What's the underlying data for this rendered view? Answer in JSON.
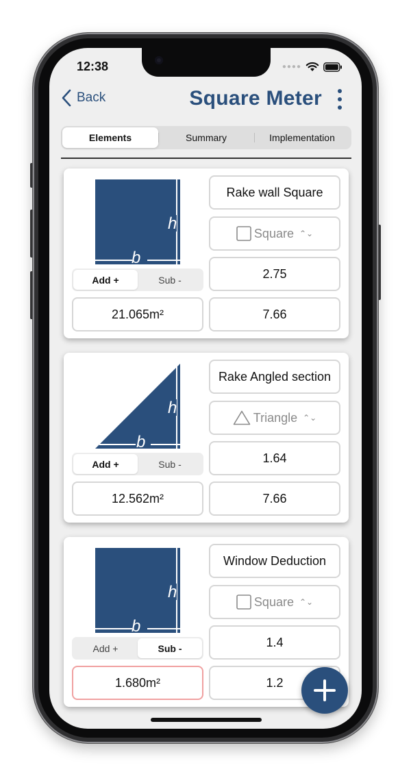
{
  "status": {
    "time": "12:38"
  },
  "nav": {
    "back_label": "Back",
    "title": "Square Meter"
  },
  "tabs": [
    {
      "label": "Elements",
      "active": true
    },
    {
      "label": "Summary",
      "active": false
    },
    {
      "label": "Implementation",
      "active": false
    }
  ],
  "cards": [
    {
      "shape": "square",
      "name": "Rake wall Square",
      "shape_label": "Square",
      "height": "2.75",
      "base": "7.66",
      "area": "21.065m²",
      "add_label": "Add +",
      "sub_label": "Sub -",
      "mode": "add"
    },
    {
      "shape": "triangle",
      "name": "Rake Angled section",
      "shape_label": "Triangle",
      "height": "1.64",
      "base": "7.66",
      "area": "12.562m²",
      "add_label": "Add +",
      "sub_label": "Sub -",
      "mode": "add"
    },
    {
      "shape": "square",
      "name": "Window Deduction",
      "shape_label": "Square",
      "height": "1.4",
      "base": "1.2",
      "area": "1.680m²",
      "add_label": "Add +",
      "sub_label": "Sub -",
      "mode": "sub"
    }
  ],
  "diagram_labels": {
    "h": "h",
    "b": "b"
  },
  "colors": {
    "accent": "#2a4f7c",
    "background": "#efefef",
    "card": "#ffffff",
    "warn_border": "#f0a0a0"
  }
}
